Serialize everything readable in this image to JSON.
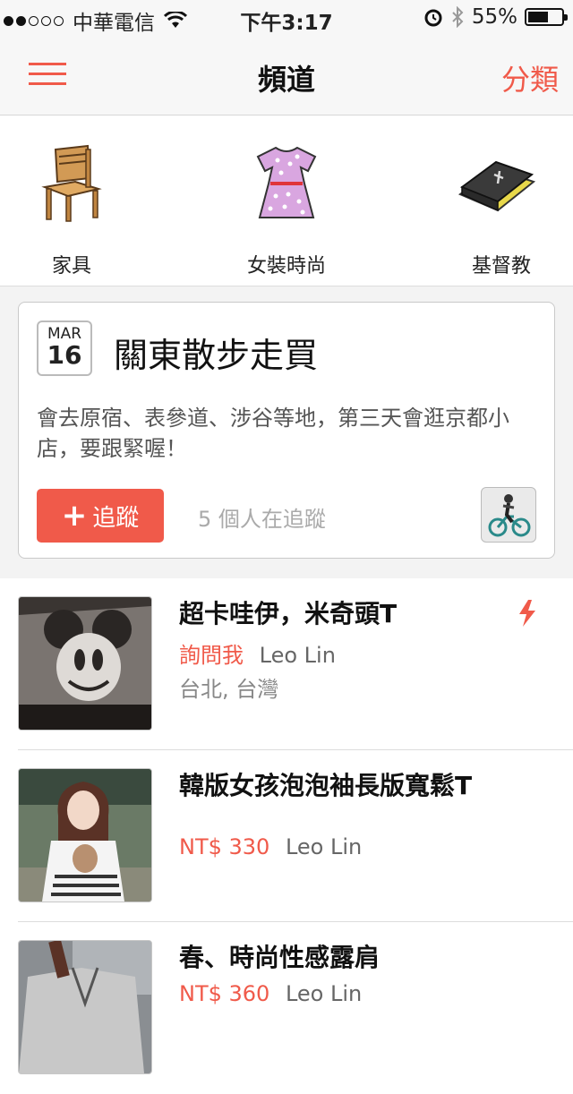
{
  "status_bar": {
    "carrier": "中華電信",
    "time": "下午3:17",
    "battery": "55%",
    "battery_level": 0.55,
    "signal_bars_filled": 2,
    "signal_bars_total": 5
  },
  "nav": {
    "title": "頻道",
    "right_label": "分類",
    "menu_icon": "hamburger-icon"
  },
  "categories": [
    {
      "label": "家具",
      "icon": "chair-icon"
    },
    {
      "label": "女裝時尚",
      "icon": "dress-icon"
    },
    {
      "label": "基督教",
      "icon": "bible-icon"
    }
  ],
  "event": {
    "month": "MAR",
    "day": "16",
    "title": "關東散步走買",
    "description": "會去原宿、表參道、涉谷等地，第三天會逛京都小店，要跟緊喔！",
    "follow_label": "追蹤",
    "followers_text": "5 個人在追蹤"
  },
  "items": [
    {
      "title": "超卡哇伊，米奇頭T",
      "price": "詢問我",
      "seller": "Leo Lin",
      "location": "台北, 台灣",
      "flash": true
    },
    {
      "title": "韓版女孩泡泡袖長版寬鬆T",
      "price": "NT$ 330",
      "seller": "Leo Lin",
      "location": "",
      "flash": false
    },
    {
      "title": "春、時尚性感露肩",
      "price": "NT$ 360",
      "seller": "Leo Lin",
      "location": "",
      "flash": false
    }
  ],
  "colors": {
    "accent": "#f05a4a",
    "background": "#f3f3f3"
  }
}
